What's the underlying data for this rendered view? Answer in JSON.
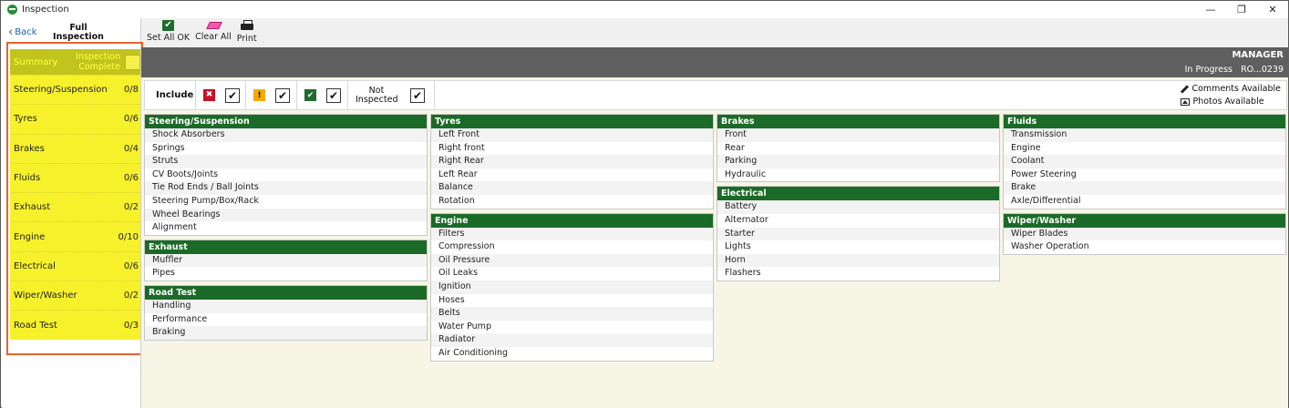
{
  "window": {
    "title": "Inspection",
    "controls": {
      "minimize": "—",
      "restore": "❐",
      "close": "✕"
    }
  },
  "nav": {
    "back_label": "Back",
    "title": "Full Inspection"
  },
  "toolbar": {
    "set_all_ok_label": "Set All OK",
    "clear_all_label": "Clear All",
    "print_label": "Print"
  },
  "status": {
    "role": "MANAGER",
    "state": "In Progress",
    "ro": "RO...0239"
  },
  "filter": {
    "include_label": "Include",
    "fail_glyph": "✖",
    "warn_glyph": "!",
    "ok_glyph": "✔",
    "check_glyph": "✔",
    "not_inspected_label": "Not Inspected",
    "comments_label": "Comments Available",
    "photos_label": "Photos Available"
  },
  "sidebar": {
    "summary_label": "Summary",
    "inspection_complete_label": "Inspection Complete",
    "items": [
      {
        "label": "Steering/Suspension",
        "count": "0/8"
      },
      {
        "label": "Tyres",
        "count": "0/6"
      },
      {
        "label": "Brakes",
        "count": "0/4"
      },
      {
        "label": "Fluids",
        "count": "0/6"
      },
      {
        "label": "Exhaust",
        "count": "0/2"
      },
      {
        "label": "Engine",
        "count": "0/10"
      },
      {
        "label": "Electrical",
        "count": "0/6"
      },
      {
        "label": "Wiper/Washer",
        "count": "0/2"
      },
      {
        "label": "Road Test",
        "count": "0/3"
      }
    ]
  },
  "columns": [
    [
      {
        "title": "Steering/Suspension",
        "items": [
          "Shock Absorbers",
          "Springs",
          "Struts",
          "CV Boots/Joints",
          "Tie Rod Ends / Ball Joints",
          "Steering Pump/Box/Rack",
          "Wheel Bearings",
          "Alignment"
        ]
      },
      {
        "title": "Exhaust",
        "items": [
          "Muffler",
          "Pipes"
        ]
      },
      {
        "title": "Road Test",
        "items": [
          "Handling",
          "Performance",
          "Braking"
        ]
      }
    ],
    [
      {
        "title": "Tyres",
        "items": [
          "Left Front",
          "Right front",
          "Right Rear",
          "Left Rear",
          "Balance",
          "Rotation"
        ]
      },
      {
        "title": "Engine",
        "items": [
          "Filters",
          "Compression",
          "Oil Pressure",
          "Oil Leaks",
          "Ignition",
          "Hoses",
          "Belts",
          "Water Pump",
          "Radiator",
          "Air Conditioning"
        ]
      }
    ],
    [
      {
        "title": "Brakes",
        "items": [
          "Front",
          "Rear",
          "Parking",
          "Hydraulic"
        ]
      },
      {
        "title": "Electrical",
        "items": [
          "Battery",
          "Alternator",
          "Starter",
          "Lights",
          "Horn",
          "Flashers"
        ]
      }
    ],
    [
      {
        "title": "Fluids",
        "items": [
          "Transmission",
          "Engine",
          "Coolant",
          "Power Steering",
          "Brake",
          "Axle/Differential"
        ]
      },
      {
        "title": "Wiper/Washer",
        "items": [
          "Wiper Blades",
          "Washer Operation"
        ]
      }
    ]
  ],
  "colors": {
    "section_header": "#1b6a27",
    "sidebar_highlight": "#f7f12c",
    "sidebar_frame": "#e8622a",
    "status_bar": "#5f5f5f"
  }
}
